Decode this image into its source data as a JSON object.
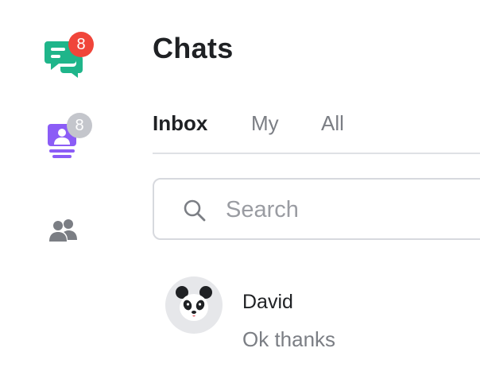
{
  "nav": {
    "chats": {
      "icon": "chat-bubbles-icon",
      "badge": "8",
      "color": "#1fb58a",
      "badge_color": "#f0453a"
    },
    "tickets": {
      "icon": "contact-card-icon",
      "badge": "8",
      "color": "#8b5cf6",
      "badge_color": "#c4c6cc"
    },
    "people": {
      "icon": "people-icon",
      "color": "#7b7e84"
    }
  },
  "header": {
    "title": "Chats"
  },
  "tabs": [
    {
      "label": "Inbox",
      "active": true
    },
    {
      "label": "My",
      "active": false
    },
    {
      "label": "All",
      "active": false
    }
  ],
  "search": {
    "placeholder": "Search",
    "value": "",
    "icon": "search-icon"
  },
  "chats": [
    {
      "name": "David",
      "preview": "Ok thanks",
      "avatar": "panda-avatar"
    }
  ]
}
